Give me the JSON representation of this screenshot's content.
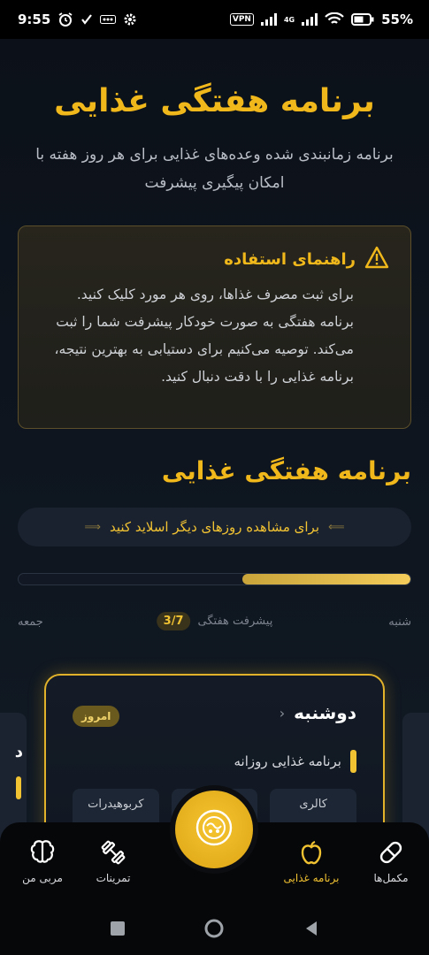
{
  "status_bar": {
    "time": "9:55",
    "vpn": "VPN",
    "network": "4G",
    "battery": "55%"
  },
  "header": {
    "title": "برنامه هفتگی غذایی",
    "subtitle": "برنامه زمانبندی شده وعده‌های غذایی برای هر روز هفته با امکان پیگیری پیشرفت"
  },
  "guide": {
    "title": "راهنمای استفاده",
    "body": "برای ثبت مصرف غذاها، روی هر مورد کلیک کنید. برنامه هفتگی به صورت خودکار پیشرفت شما را ثبت می‌کند. توصیه می‌کنیم برای دستیابی به بهترین نتیجه، برنامه غذایی را با دقت دنبال کنید."
  },
  "section": {
    "title": "برنامه هفتگی غذایی"
  },
  "slide_hint": {
    "text": "برای مشاهده روزهای دیگر اسلاید کنید"
  },
  "progress": {
    "label": "پیشرفت هفتگی",
    "badge": "3/7",
    "fraction": 0.43,
    "start_day": "شنبه",
    "end_day": "جمعه"
  },
  "day_card": {
    "day": "دوشنبه",
    "today_badge": "امروز",
    "subtitle": "برنامه غذایی روزانه",
    "stats": [
      "کالری",
      "پروتئین",
      "کربوهیدرات"
    ]
  },
  "peek_left_char": "د",
  "bottom_nav": {
    "items": [
      {
        "label": "مربی من",
        "icon": "brain-icon",
        "active": false
      },
      {
        "label": "تمرینات",
        "icon": "dumbbell-icon",
        "active": false
      },
      {
        "label": "برنامه غذایی",
        "icon": "apple-icon",
        "active": true
      },
      {
        "label": "مکمل‌ها",
        "icon": "pill-icon",
        "active": false
      }
    ],
    "fab_icon": "food-plate-icon"
  },
  "colors": {
    "accent": "#f1b81c",
    "background": "#0e141d"
  }
}
